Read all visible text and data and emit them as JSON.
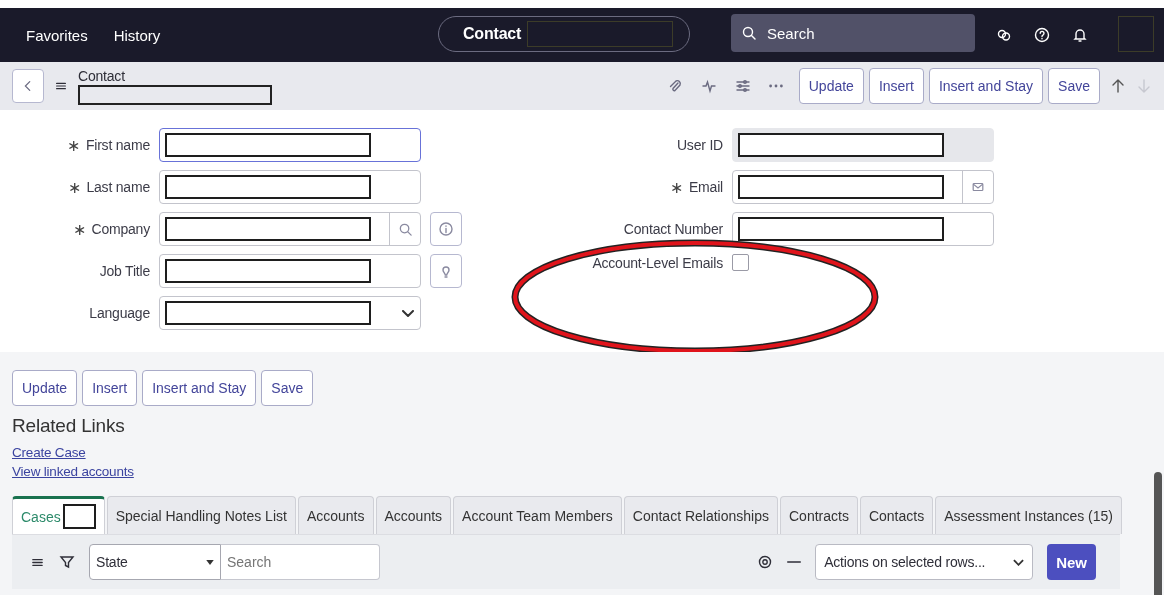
{
  "top_nav": {
    "links": [
      {
        "label": "Favorites"
      },
      {
        "label": "History"
      }
    ],
    "title": "Contact",
    "title_redacted": true,
    "search": {
      "placeholder": "Search"
    },
    "avatar_redacted": true
  },
  "record_header": {
    "title": "Contact",
    "subtitle_redacted": true,
    "buttons": [
      "Update",
      "Insert",
      "Insert and Stay",
      "Save"
    ]
  },
  "form": {
    "left": [
      {
        "label": "First name",
        "required_mark": "∗",
        "kind": "text",
        "focused": true,
        "redacted": true
      },
      {
        "label": "Last name",
        "required_mark": "∗",
        "kind": "text",
        "focused": false,
        "redacted": true
      },
      {
        "label": "Company",
        "required_mark": "∗",
        "kind": "reference",
        "focused": false,
        "redacted": true
      },
      {
        "label": "Job Title",
        "kind": "suggest",
        "focused": false,
        "redacted": true
      },
      {
        "label": "Language",
        "kind": "select",
        "focused": false,
        "redacted": true
      }
    ],
    "right": [
      {
        "label": "User ID",
        "kind": "readonly",
        "focused": false,
        "redacted": true
      },
      {
        "label": "Email",
        "required_mark": "∗",
        "kind": "email",
        "focused": false,
        "redacted": true
      },
      {
        "label": "Contact Number",
        "kind": "text",
        "focused": false,
        "redacted": true
      },
      {
        "label": "Account-Level Emails",
        "kind": "checkbox",
        "checked": false,
        "circled": true
      }
    ]
  },
  "bottom_buttons": [
    "Update",
    "Insert",
    "Insert and Stay",
    "Save"
  ],
  "related_links": {
    "title": "Related Links",
    "links": [
      "Create Case",
      "View linked accounts"
    ]
  },
  "tabs": [
    {
      "label": "Cases",
      "selected": true,
      "redacted": true
    },
    {
      "label": "Special Handling Notes List",
      "selected": false
    },
    {
      "label": "Accounts",
      "selected": false
    },
    {
      "label": "Accounts",
      "selected": false
    },
    {
      "label": "Account Team Members",
      "selected": false
    },
    {
      "label": "Contact Relationships",
      "selected": false
    },
    {
      "label": "Contracts",
      "selected": false
    },
    {
      "label": "Contacts",
      "selected": false
    },
    {
      "label": "Assessment Instances (15)",
      "selected": false
    }
  ],
  "list_toolbar": {
    "filter_field": "State",
    "search": {
      "placeholder": "Search"
    },
    "actions": "Actions on selected rows...",
    "new_button": "New"
  }
}
